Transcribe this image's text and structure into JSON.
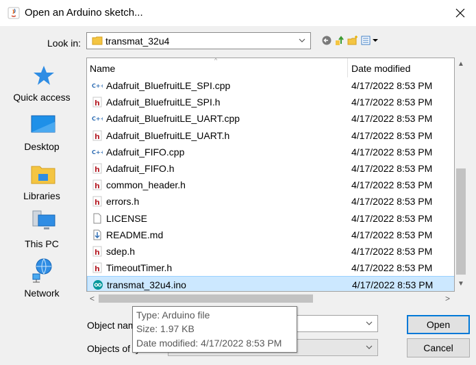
{
  "window": {
    "title": "Open an Arduino sketch...",
    "close_label": "✕"
  },
  "lookin": {
    "label": "Look in:",
    "value": "transmat_32u4"
  },
  "places": [
    {
      "label": "Quick access",
      "icon": "quick-access-star-icon"
    },
    {
      "label": "Desktop",
      "icon": "desktop-icon"
    },
    {
      "label": "Libraries",
      "icon": "libraries-folder-icon"
    },
    {
      "label": "This PC",
      "icon": "this-pc-icon"
    },
    {
      "label": "Network",
      "icon": "network-icon"
    }
  ],
  "columns": {
    "name": "Name",
    "date": "Date modified"
  },
  "files": [
    {
      "name": "Adafruit_BluefruitLE_SPI.cpp",
      "date": "4/17/2022 8:53 PM",
      "icon": "cpp-file-icon"
    },
    {
      "name": "Adafruit_BluefruitLE_SPI.h",
      "date": "4/17/2022 8:53 PM",
      "icon": "h-file-icon"
    },
    {
      "name": "Adafruit_BluefruitLE_UART.cpp",
      "date": "4/17/2022 8:53 PM",
      "icon": "cpp-file-icon"
    },
    {
      "name": "Adafruit_BluefruitLE_UART.h",
      "date": "4/17/2022 8:53 PM",
      "icon": "h-file-icon"
    },
    {
      "name": "Adafruit_FIFO.cpp",
      "date": "4/17/2022 8:53 PM",
      "icon": "cpp-file-icon"
    },
    {
      "name": "Adafruit_FIFO.h",
      "date": "4/17/2022 8:53 PM",
      "icon": "h-file-icon"
    },
    {
      "name": "common_header.h",
      "date": "4/17/2022 8:53 PM",
      "icon": "h-file-icon"
    },
    {
      "name": "errors.h",
      "date": "4/17/2022 8:53 PM",
      "icon": "h-file-icon"
    },
    {
      "name": "LICENSE",
      "date": "4/17/2022 8:53 PM",
      "icon": "blank-file-icon"
    },
    {
      "name": "README.md",
      "date": "4/17/2022 8:53 PM",
      "icon": "md-file-icon"
    },
    {
      "name": "sdep.h",
      "date": "4/17/2022 8:53 PM",
      "icon": "h-file-icon"
    },
    {
      "name": "TimeoutTimer.h",
      "date": "4/17/2022 8:53 PM",
      "icon": "h-file-icon"
    },
    {
      "name": "transmat_32u4.ino",
      "date": "4/17/2022 8:53 PM",
      "icon": "arduino-file-icon",
      "selected": true
    }
  ],
  "object_name": {
    "label": "Object nam",
    "value": ""
  },
  "object_type": {
    "label": "Objects of ty",
    "value": ""
  },
  "buttons": {
    "open": "Open",
    "cancel": "Cancel"
  },
  "tooltip": {
    "type": "Type: Arduino file",
    "size": "Size: 1.97 KB",
    "date": "Date modified: 4/17/2022 8:53 PM"
  },
  "colors": {
    "selection_bg": "#cce8ff",
    "accent": "#0078d7",
    "h_icon": "#b8262f",
    "cpp_icon": "#2e6db4",
    "arduino_icon": "#00979c"
  }
}
